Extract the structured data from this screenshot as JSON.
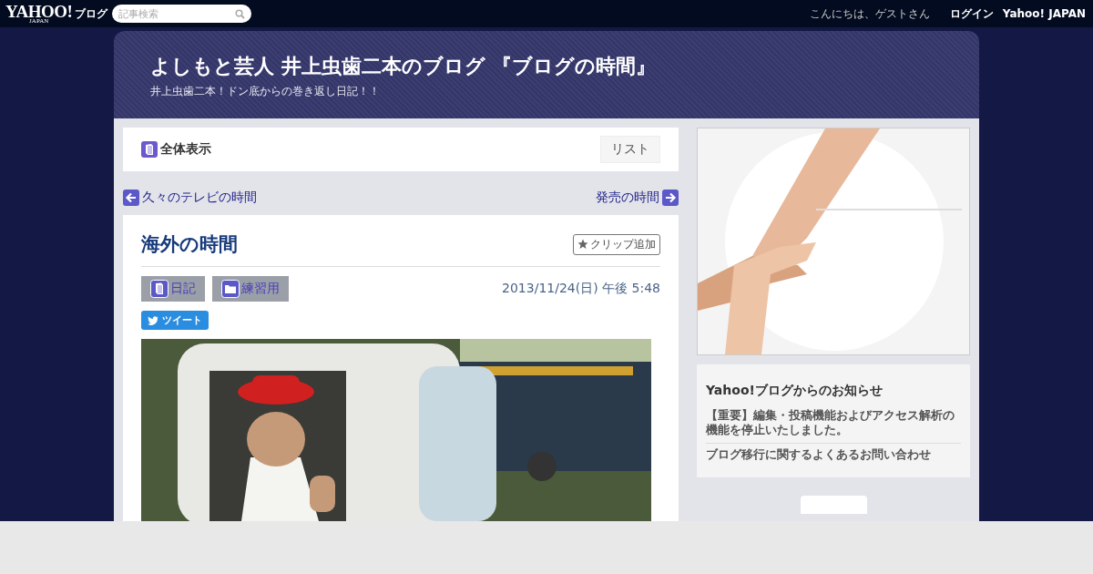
{
  "topbar": {
    "logo": "YAHOO!",
    "logo_sub": "JAPAN",
    "service": "ブログ",
    "search": {
      "placeholder": "記事検索"
    },
    "greeting": "こんにちは、ゲストさん",
    "links": [
      "ログイン",
      "Yahoo! JAPAN"
    ]
  },
  "blog": {
    "title": "よしもと芸人 井上虫歯二本のブログ 『ブログの時間』",
    "subtitle": "井上虫歯二本！ドン底からの巻き返し日記！！"
  },
  "view_bar": {
    "label": "全体表示",
    "list_button": "リスト"
  },
  "nav": {
    "prev": "久々のテレビの時間",
    "next": "発売の時間"
  },
  "article": {
    "title": "海外の時間",
    "clip_button": "クリップ追加",
    "tags": [
      {
        "kind": "book",
        "label": "日記"
      },
      {
        "kind": "folder",
        "label": "練習用"
      }
    ],
    "date": "2013/11/24(日) 午後 5:48",
    "tweet_button": "ツイート"
  },
  "sidebar": {
    "notice": {
      "title": "Yahoo!ブログからのお知らせ",
      "items": [
        "【重要】編集・投稿機能およびアクセス解析の機能を停止いたしました。",
        "ブログ移行に関するよくあるお問い合わせ"
      ]
    }
  }
}
